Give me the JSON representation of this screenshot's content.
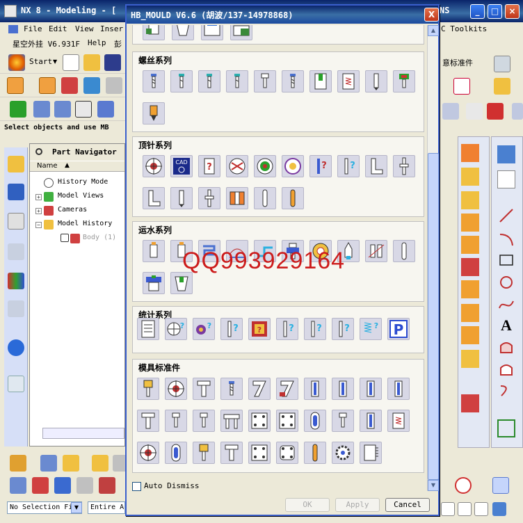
{
  "window": {
    "title": "NX 8 - Modeling - [",
    "title_right": "NS",
    "minimize": "_",
    "maximize": "□",
    "close": "×"
  },
  "menubar": {
    "items": [
      "File",
      "Edit",
      "View",
      "Inser"
    ],
    "right_items": [
      "C Toolkits"
    ],
    "items2": [
      "星空外挂 V6.931F",
      "Help",
      "彭"
    ],
    "right_label": "意标准件"
  },
  "toolbar": {
    "start_label": "Start"
  },
  "status": {
    "select_hint": "Select objects and use MB"
  },
  "navigator": {
    "title": "Part Navigator",
    "column_name": "Name",
    "rows": [
      {
        "label": "History Mode"
      },
      {
        "label": "Model Views"
      },
      {
        "label": "Cameras"
      },
      {
        "label": "Model History"
      },
      {
        "label": "Body (1)"
      }
    ]
  },
  "bottom": {
    "selection_filter": "No Selection Fi",
    "scope": "Entire A"
  },
  "dialog": {
    "title": "HB_MOULD V6.6 (胡波/137-14978868)",
    "close": "X",
    "groups": [
      {
        "key": "screw",
        "title": "螺丝系列"
      },
      {
        "key": "ejector",
        "title": "顶针系列"
      },
      {
        "key": "cooling",
        "title": "运水系列"
      },
      {
        "key": "stats",
        "title": "统计系列"
      },
      {
        "key": "mold",
        "title": "模具标准件"
      }
    ],
    "auto_dismiss": "Auto Dismiss",
    "buttons": {
      "ok": "OK",
      "apply": "Apply",
      "cancel": "Cancel"
    },
    "icon_text": {
      "cad": "CAD",
      "p": "P"
    }
  },
  "watermark": "QQ993929164",
  "colors": {
    "title_blue": "#0a246a",
    "dialog_border": "#3a5fcd",
    "watermark_red": "#cc1b1b",
    "close_red": "#c0361a"
  }
}
